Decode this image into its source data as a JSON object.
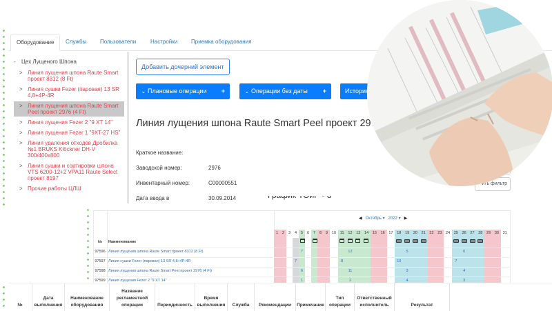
{
  "tabs": [
    "Оборудование",
    "Службы",
    "Пользователи",
    "Настройки",
    "Приемка оборудования"
  ],
  "tree": {
    "root": "Цех Лущеного Шпона",
    "items": [
      "Линия лущения шпона Raute Smart проект 8312 (8 Ft)",
      "Линия сушки Fezer (паровая) 13 SR 4,8+4P-4R",
      "Линия лущения шпона Raute Smart Peel проект 2976 (4 Ft)",
      "Линия лущения Fezer 2 \"9 XT 14\"",
      "Линия лущения Fezer 1 \"9XT-27 HS\"",
      "Линия удаления отходов Дробилка №1 BRUKS Klöckner DH-V 300/400x800",
      "Линия сушки и сортировки шпона VTS 6200-12+2 VPA11 Raute Select проект 8197",
      "Прочие работы ЦЛШ"
    ],
    "selected": 2
  },
  "main": {
    "add_child": "Добавить дочерний элемент",
    "buttons": [
      "Плановые операции",
      "Операции без даты",
      "История"
    ],
    "plus": "+",
    "title": "Линия лущения шпона Raute Smart Peel проект 2976",
    "fields": [
      {
        "label": "Краткое название:",
        "value": ""
      },
      {
        "label": "Заводской номер:",
        "value": "2976"
      },
      {
        "label": "Инвентарный номер:",
        "value": "С00000551"
      },
      {
        "label": "Дата ввода в",
        "value": "30.09.2014"
      }
    ],
    "reset_filter": "ить фильтр"
  },
  "schedule": {
    "title": "График ТОиР - 8",
    "month": "Октябрь",
    "year": "2022",
    "col_no": "№",
    "col_name": "Наименование",
    "days": 31,
    "weekends": [
      1,
      2,
      8,
      9,
      15,
      16,
      22,
      23,
      29,
      30
    ],
    "green": [
      5,
      7,
      11,
      12,
      13,
      14
    ],
    "grey": [
      4
    ],
    "blue": [
      18,
      19,
      20,
      21,
      25,
      26,
      27,
      28
    ],
    "rows": [
      {
        "no": "97596",
        "name": "Линия лущения шпона Raute Smart проект 8312 (8 Ft)",
        "vals": {
          "5": "7",
          "12": "12",
          "19": "5",
          "26": "6"
        }
      },
      {
        "no": "97597",
        "name": "Линия сушки Fezer (паровая) 13 SR 4,8+4P-4R",
        "vals": {
          "4": "7",
          "11": "8",
          "18": "10",
          "25": "7"
        }
      },
      {
        "no": "97598",
        "name": "Линия лущения шпона Raute Smart Peel проект 2976 (4 Ft)",
        "vals": {
          "5": "6",
          "12": "11",
          "19": "3",
          "26": "4"
        }
      },
      {
        "no": "97599",
        "name": "Линия лущения Fezer 2 \"9 XT 14\"",
        "vals": {
          "5": "1",
          "12": "2",
          "19": "4",
          "26": "3"
        }
      }
    ],
    "extra_row": {
      "26": "2"
    },
    "colors": {
      "weekend": "#f5c6cc",
      "green": "#c8e8cf",
      "blue": "#bde3ea",
      "grey": "#d6d8db",
      "link": "#2a6db5"
    }
  },
  "bottom_headers": [
    "№",
    "Дата выполнения",
    "Наименование оборудования",
    "Название регламентной операции",
    "Периодичность",
    "Время выполнения",
    "Служба",
    "Рекомендации",
    "Примечание",
    "Тип операции",
    "Ответственный исполнитель",
    "Результат"
  ]
}
